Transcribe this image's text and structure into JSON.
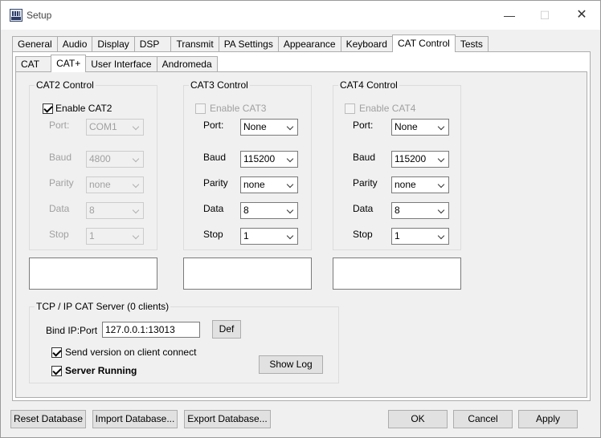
{
  "window": {
    "title": "Setup"
  },
  "main_tabs": [
    "General",
    "Audio",
    "Display",
    "DSP",
    "Transmit",
    "PA Settings",
    "Appearance",
    "Keyboard",
    "CAT Control",
    "Tests"
  ],
  "sub_tabs": [
    "CAT",
    "CAT+",
    "User Interface",
    "Andromeda"
  ],
  "field_labels": {
    "port": "Port:",
    "baud": "Baud",
    "parity": "Parity",
    "data": "Data",
    "stop": "Stop"
  },
  "cat2": {
    "title": "CAT2 Control",
    "enable_label": "Enable CAT2",
    "enabled": true,
    "port": "COM1",
    "baud": "4800",
    "parity": "none",
    "data": "8",
    "stop": "1"
  },
  "cat3": {
    "title": "CAT3 Control",
    "enable_label": "Enable CAT3",
    "enabled": false,
    "port": "None",
    "baud": "115200",
    "parity": "none",
    "data": "8",
    "stop": "1"
  },
  "cat4": {
    "title": "CAT4 Control",
    "enable_label": "Enable CAT4",
    "enabled": false,
    "port": "None",
    "baud": "115200",
    "parity": "none",
    "data": "8",
    "stop": "1"
  },
  "tcp": {
    "title": "TCP / IP CAT Server (0 clients)",
    "bind_label": "Bind IP:Port",
    "bind_value": "127.0.0.1:13013",
    "def_button": "Def",
    "send_version_label": "Send version on client connect",
    "server_running_label": "Server Running",
    "show_log_button": "Show Log"
  },
  "footer": {
    "reset": "Reset Database",
    "import": "Import Database...",
    "export": "Export Database...",
    "ok": "OK",
    "cancel": "Cancel",
    "apply": "Apply"
  }
}
